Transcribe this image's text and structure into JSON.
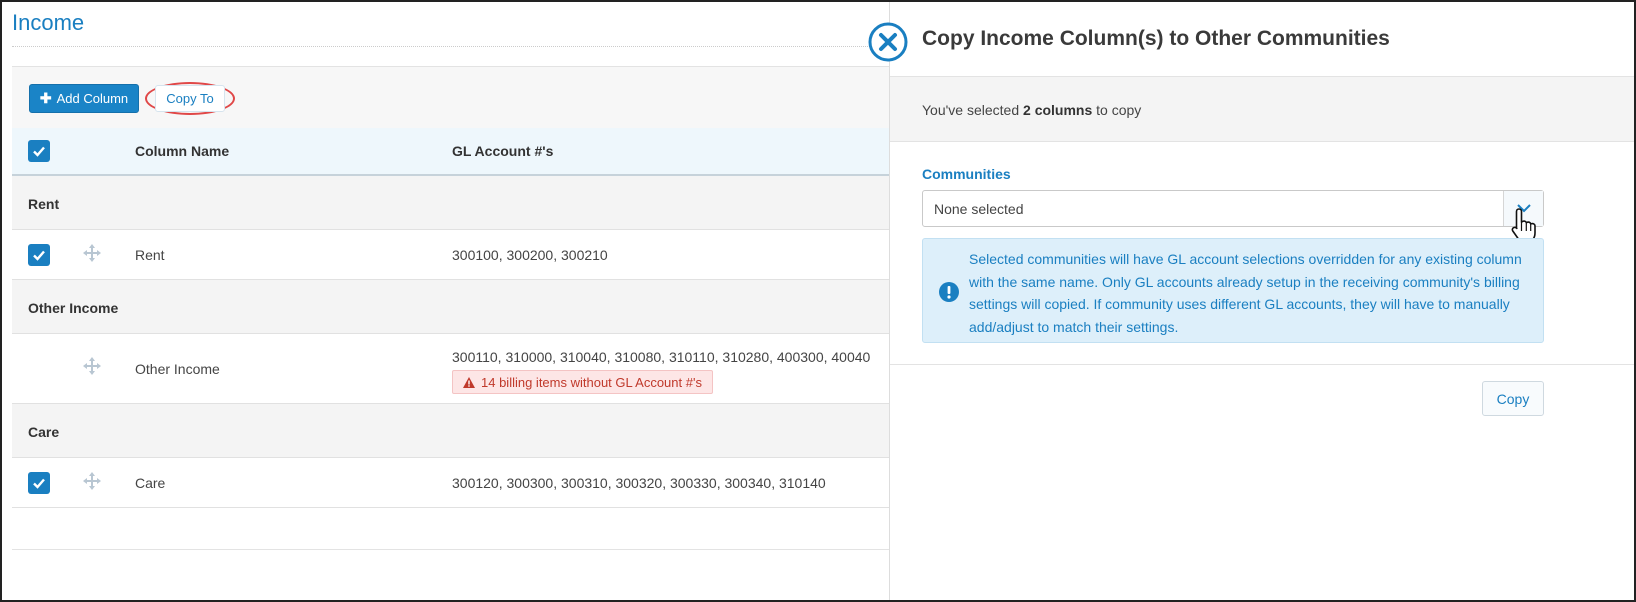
{
  "page": {
    "title": "Income"
  },
  "toolbar": {
    "add_column_label": "Add Column",
    "copy_to_label": "Copy To"
  },
  "table": {
    "headers": {
      "column_name": "Column Name",
      "gl_accounts": "GL Account #'s"
    },
    "groups": [
      {
        "label": "Rent",
        "rows": [
          {
            "name": "Rent",
            "accounts": "300100, 300200, 300210",
            "checked": true
          }
        ]
      },
      {
        "label": "Other Income",
        "rows": [
          {
            "name": "Other Income",
            "accounts": "300110, 310000, 310040, 310080, 310110, 310280, 400300, 40040",
            "checked": false,
            "warning": "14 billing items without GL Account #'s"
          }
        ]
      },
      {
        "label": "Care",
        "rows": [
          {
            "name": "Care",
            "accounts": "300120, 300300, 300310, 300320, 300330, 300340, 310140",
            "checked": true
          }
        ]
      }
    ]
  },
  "panel": {
    "title": "Copy Income Column(s) to Other Communities",
    "selected_prefix": "You've selected ",
    "selected_count": "2 columns",
    "selected_suffix": " to copy",
    "communities_label": "Communities",
    "communities_value": "None selected",
    "info_text": "Selected communities will have GL account selections overridden for any existing column with the same name. Only GL accounts already setup in the receiving community's billing settings will copied. If community uses different GL accounts, they will have to manually add/adjust to match their settings.",
    "copy_label": "Copy"
  },
  "colors": {
    "accent": "#1a7fc1",
    "warning": "#c0392b",
    "annotation": "#e04848",
    "info_bg": "#ddeffa"
  }
}
